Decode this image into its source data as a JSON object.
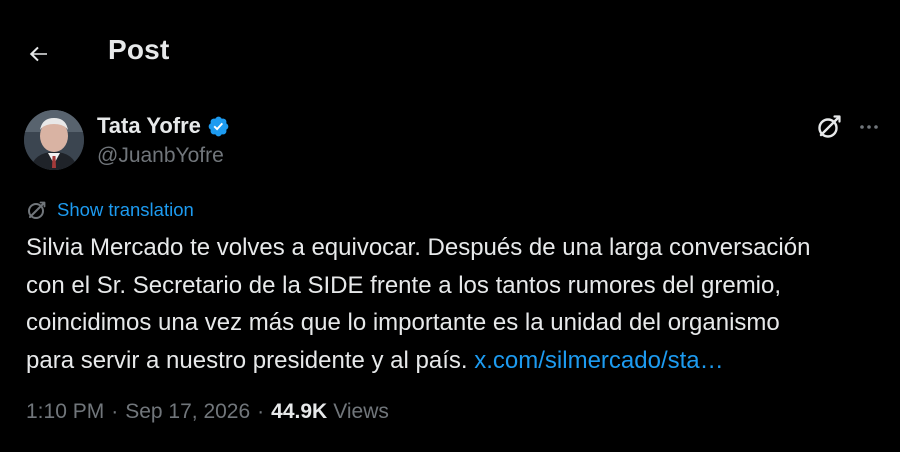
{
  "header": {
    "title": "Post"
  },
  "author": {
    "name": "Tata Yofre",
    "handle": "@JuanbYofre",
    "verified": true
  },
  "translation": {
    "label": "Show translation"
  },
  "tweet": {
    "line1": "Silvia Mercado te volves a equivocar. Después de una larga conversación",
    "line2": "con el Sr. Secretario de la SIDE frente a los tantos rumores del gremio,",
    "line3": "coincidimos una vez más que lo importante es la unidad del organismo",
    "line4_text": "para servir a nuestro presidente y al país.",
    "link": "x.com/silmercado/sta…"
  },
  "meta": {
    "time": "1:10 PM",
    "separator": "·",
    "date": "Sep 17, 2026",
    "views_count": "44.9K",
    "views_label": "Views"
  },
  "colors": {
    "background": "#000000",
    "text_primary": "#e7e9ea",
    "text_secondary": "#71767b",
    "accent": "#1d9bf0"
  },
  "icons": {
    "back": "arrow-left-icon",
    "verified": "verified-badge-icon",
    "grok": "grok-icon",
    "more": "more-horizontal-icon",
    "translate": "translate-icon"
  }
}
